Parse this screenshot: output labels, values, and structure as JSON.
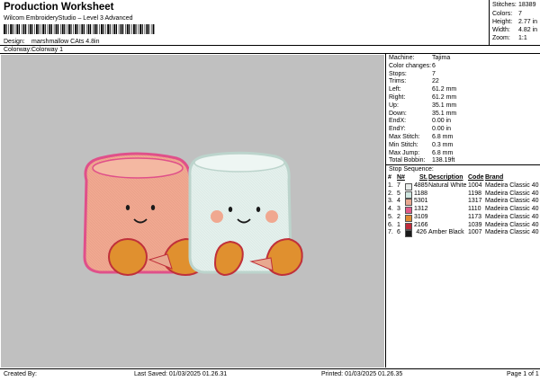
{
  "header": {
    "title": "Production Worksheet",
    "subtitle": "Wilcom EmbroideryStudio – Level 3 Advanced"
  },
  "design": {
    "label": "Design:",
    "value": "marshmallow CAts 4.8in"
  },
  "colorway": {
    "label": "Colorway:",
    "value": "Colorway 1"
  },
  "summary": [
    {
      "label": "Stitches:",
      "value": "18389"
    },
    {
      "label": "Colors:",
      "value": "7"
    },
    {
      "label": "Height:",
      "value": "2.77 in"
    },
    {
      "label": "Width:",
      "value": "4.82 in"
    },
    {
      "label": "Zoom:",
      "value": "1:1"
    }
  ],
  "machine_info": [
    {
      "label": "Machine:",
      "value": "Tajima"
    },
    {
      "label": "Color changes:",
      "value": "6"
    },
    {
      "label": "Stops:",
      "value": "7"
    },
    {
      "label": "Trims:",
      "value": "22"
    },
    {
      "label": "Left:",
      "value": "61.2 mm"
    },
    {
      "label": "Right:",
      "value": "61.2 mm"
    },
    {
      "label": "Up:",
      "value": "35.1 mm"
    },
    {
      "label": "Down:",
      "value": "35.1 mm"
    },
    {
      "label": "EndX:",
      "value": "0.00 in"
    },
    {
      "label": "EndY:",
      "value": "0.00 in"
    },
    {
      "label": "Max Stitch:",
      "value": "6.8 mm"
    },
    {
      "label": "Min Stitch:",
      "value": "0.3 mm"
    },
    {
      "label": "Max Jump:",
      "value": "6.8 mm"
    },
    {
      "label": "Total Bobbin:",
      "value": "138.19ft"
    }
  ],
  "stop_sequence": {
    "title": "Stop Sequence:",
    "headers": {
      "num": "#",
      "n": "N#",
      "st": "St.",
      "description": "Description",
      "code": "Code",
      "brand": "Brand"
    },
    "rows": [
      {
        "num": "1.",
        "n": "7",
        "color": "#e8ecea",
        "st": "4885",
        "description": "Natural White",
        "code": "1004",
        "brand": "Madeira Classic 40"
      },
      {
        "num": "2.",
        "n": "5",
        "color": "#cfe6e0",
        "st": "1188",
        "description": "",
        "code": "1198",
        "brand": "Madeira Classic 40"
      },
      {
        "num": "3.",
        "n": "4",
        "color": "#e8a890",
        "st": "5301",
        "description": "",
        "code": "1317",
        "brand": "Madeira Classic 40"
      },
      {
        "num": "4.",
        "n": "3",
        "color": "#e05a88",
        "st": "1312",
        "description": "",
        "code": "1110",
        "brand": "Madeira Classic 40"
      },
      {
        "num": "5.",
        "n": "2",
        "color": "#e08a32",
        "st": "3109",
        "description": "",
        "code": "1173",
        "brand": "Madeira Classic 40"
      },
      {
        "num": "6.",
        "n": "1",
        "color": "#c02a3a",
        "st": "2166",
        "description": "",
        "code": "1039",
        "brand": "Madeira Classic 40"
      },
      {
        "num": "7.",
        "n": "6",
        "color": "#1a1a1a",
        "st": "426",
        "description": "Amber Black",
        "code": "1007",
        "brand": "Madeira Classic 40"
      }
    ]
  },
  "footer": {
    "created_by": "Created By:",
    "last_saved": "Last Saved: 01/03/2025 01.26.31",
    "printed": "Printed: 01/03/2025 01.26.35",
    "page": "Page 1 of 1"
  }
}
